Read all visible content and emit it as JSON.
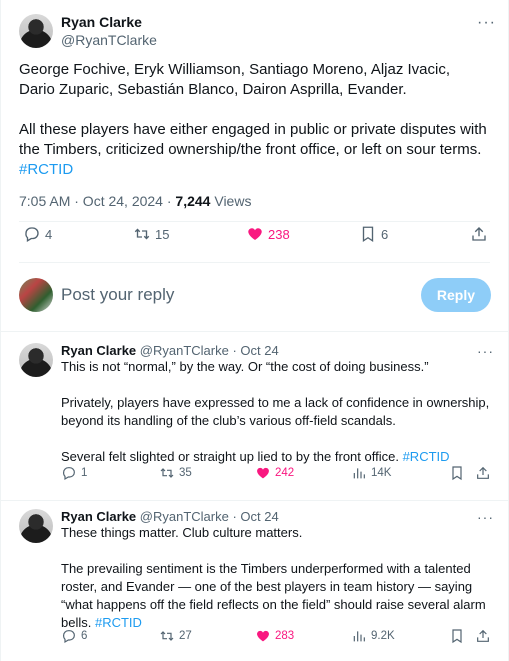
{
  "main": {
    "author_name": "Ryan Clarke",
    "author_handle": "@RyanTClarke",
    "paragraphs": [
      "George Fochive, Eryk Williamson, Santiago Moreno, Aljaz Ivacic, Dario Zuparic, Sebastián Blanco, Dairon Asprilla, Evander.",
      "All these players have either engaged in public or private disputes with the Timbers, criticized ownership/the front office, or left on sour terms."
    ],
    "hashtag": "#RCTID",
    "time": "7:05 AM · Oct 24, 2024 · ",
    "views_count": "7,244",
    "views_label": " Views",
    "replies": "4",
    "reposts": "15",
    "likes": "238",
    "bookmarks": "6"
  },
  "reply_box": {
    "placeholder": "Post your reply",
    "button": "Reply"
  },
  "replies": [
    {
      "author_name": "Ryan Clarke",
      "author_handle": "@RyanTClarke · Oct 24",
      "paragraphs": [
        "This is not “normal,” by the way. Or “the cost of doing business.”",
        "Privately, players have expressed to me a lack of confidence in ownership, beyond its handling of the club’s various off-field scandals.",
        "Several felt slighted or straight up lied to by the front office."
      ],
      "hashtag": "#RCTID",
      "replies": "1",
      "reposts": "35",
      "likes": "242",
      "views": "14K"
    },
    {
      "author_name": "Ryan Clarke",
      "author_handle": "@RyanTClarke · Oct 24",
      "paragraphs": [
        "These things matter. Club culture matters.",
        "The prevailing sentiment is the Timbers underperformed with a talented roster, and Evander — one of the best players in team history — saying “what happens off the field reflects on the field” should raise several alarm bells."
      ],
      "hashtag": "#RCTID",
      "replies": "6",
      "reposts": "27",
      "likes": "283",
      "views": "9.2K"
    }
  ],
  "colors": {
    "accent": "#1d9bf0",
    "like": "#f91880",
    "muted": "#536471",
    "reply_button_disabled": "#8ecdf8"
  }
}
